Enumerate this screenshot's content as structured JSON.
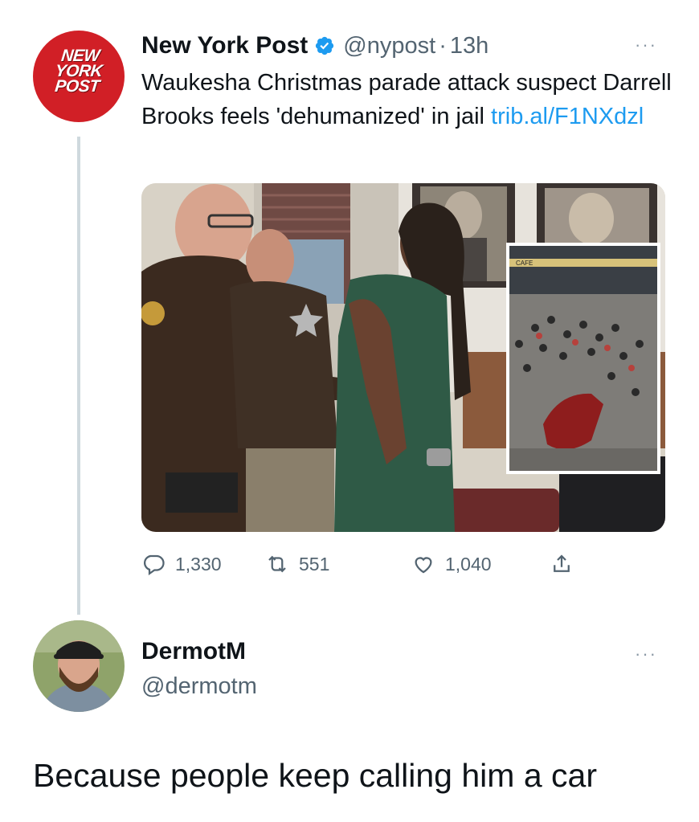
{
  "tweet": {
    "author_logo_text": [
      "NEW",
      "YORK",
      "POST"
    ],
    "display_name": "New York Post",
    "handle": "@nypost",
    "separator": "·",
    "time": "13h",
    "more_label": "···",
    "text_main": "Waukesha Christmas parade attack suspect Darrell Brooks feels 'dehumanized' in jail",
    "link": "trib.al/F1NXdzl",
    "media_inset_signs": [
      "CAFE"
    ],
    "stats": {
      "replies": "1,330",
      "retweets": "551",
      "likes": "1,040"
    },
    "colors": {
      "verified": "#1d9bf0",
      "link": "#1d9bf0",
      "brand_red": "#d11f26",
      "muted": "#536471"
    },
    "icons": [
      "verified-badge-icon",
      "more-icon",
      "reply-icon",
      "retweet-icon",
      "like-icon",
      "share-icon"
    ]
  },
  "reply": {
    "display_name": "DermotM",
    "handle": "@dermotm",
    "more_label": "···",
    "text": "Because people keep calling him a car"
  }
}
